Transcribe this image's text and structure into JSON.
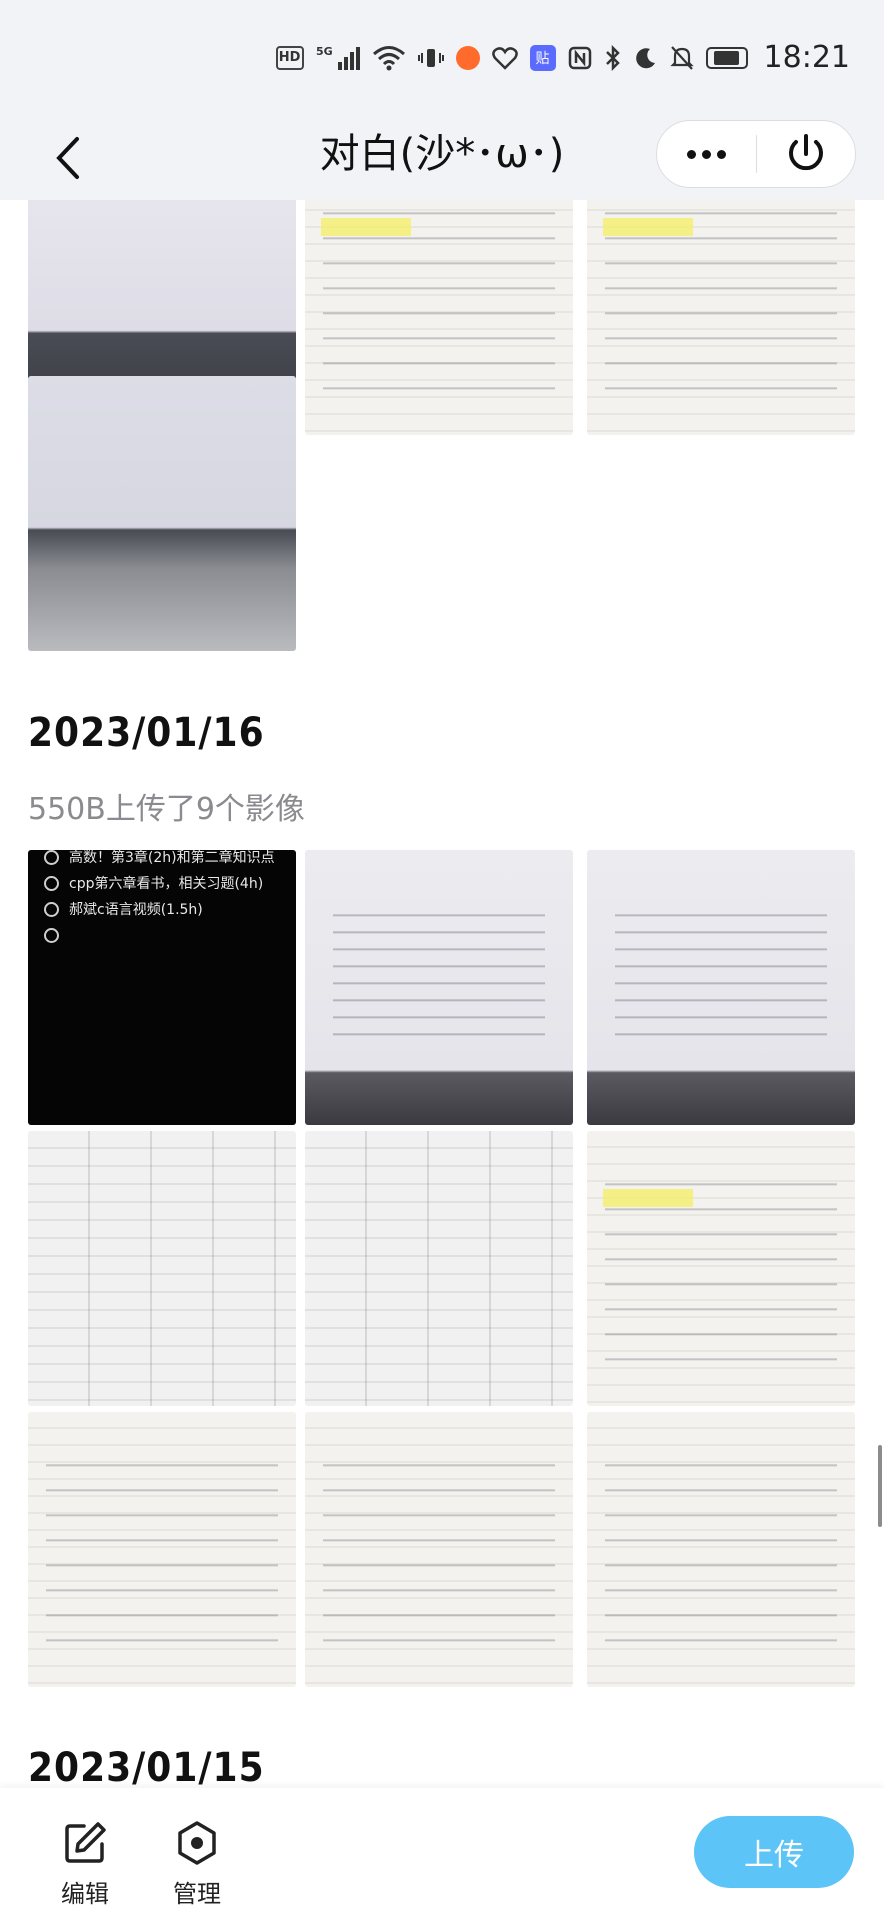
{
  "status_bar": {
    "hd": "HD",
    "signal": "5G",
    "tag": "贴",
    "time": "18:21"
  },
  "nav": {
    "title": "对白(沙*･ω･)"
  },
  "sections": [
    {
      "date": "2023/01/16",
      "info": "550B上传了9个影像",
      "todo_items": [
        "高数！第3章(2h)和第二章知识点",
        "cpp第六章看书，相关习题(4h)",
        "郝斌c语言视频(1.5h)"
      ]
    },
    {
      "date": "2023/01/15"
    }
  ],
  "bottom_bar": {
    "edit_label": "编辑",
    "manage_label": "管理",
    "upload_label": "上传"
  },
  "colors": {
    "accent": "#5cc4f7",
    "header_bg": "#f2f3f7"
  }
}
